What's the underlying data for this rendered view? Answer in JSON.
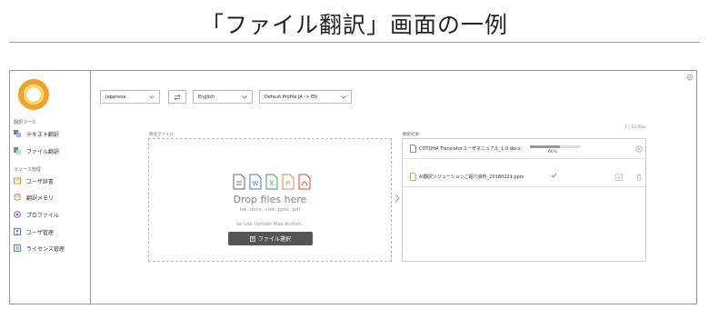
{
  "page_title": "「ファイル翻訳」画面の一例",
  "sidebar": {
    "section_tools": "翻訳ツール",
    "section_resources": "リソース管理",
    "items": [
      {
        "label": "テキスト翻訳",
        "icon": "text-translate-icon"
      },
      {
        "label": "ファイル翻訳",
        "icon": "file-translate-icon"
      },
      {
        "label": "ユーザ辞書",
        "icon": "dictionary-icon"
      },
      {
        "label": "翻訳メモリ",
        "icon": "database-icon"
      },
      {
        "label": "プロファイル",
        "icon": "profile-icon"
      },
      {
        "label": "ユーザ管理",
        "icon": "user-admin-icon"
      },
      {
        "label": "ライセンス管理",
        "icon": "license-icon"
      }
    ]
  },
  "toolbar": {
    "source_language": "Japanese",
    "target_language": "English",
    "profile": "Default Profile JA -> EN"
  },
  "files_count": "2 / 10 files",
  "source_panel": {
    "label": "原文ファイル:",
    "drop_title": "Drop files here",
    "drop_types": "txt, docx, xlsx, pptx, pdf",
    "drop_alt": "or use Upload files button.",
    "upload_button": "ファイル選択"
  },
  "results_panel": {
    "label": "翻訳結果:",
    "rows": [
      {
        "name": "COTOHA Translatorユーザマニュアル_1.0.docx",
        "progress_percent": 60,
        "progress_text": "60%"
      },
      {
        "name": "AI翻訳ソリューションご紹介資料_20180221.pptx",
        "status": "completed"
      }
    ]
  },
  "colors": {
    "logo_orange": "#f2a22a",
    "logo_yellow": "#f8d24a",
    "upload_button_bg": "#555555",
    "docx_blue": "#4a78c2",
    "xlsx_green": "#3f9e5a",
    "pptx_orange": "#e58a2f",
    "pdf_red": "#d9443a"
  }
}
